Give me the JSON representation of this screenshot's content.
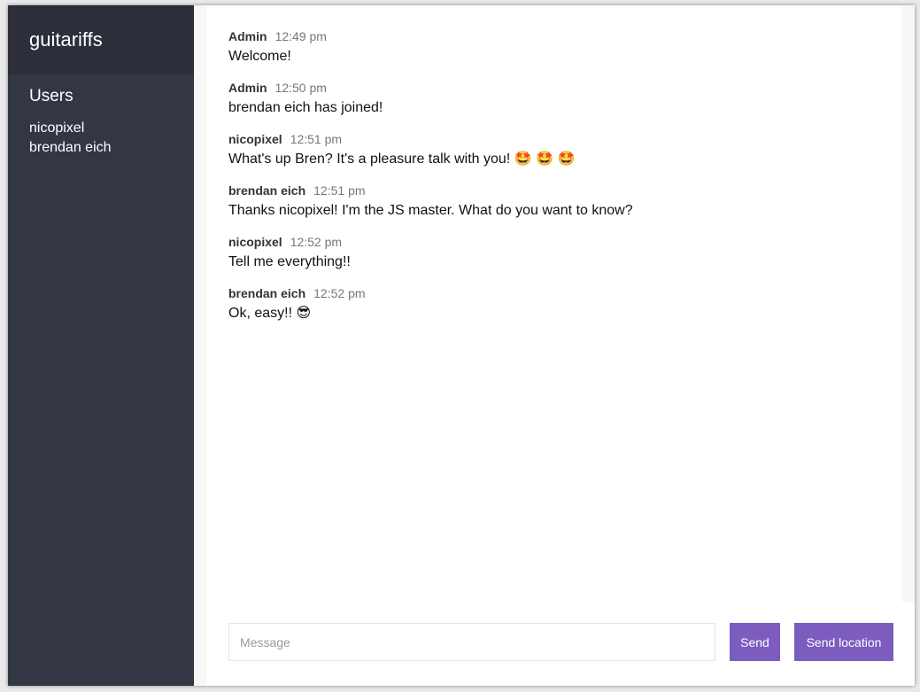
{
  "sidebar": {
    "room_name": "guitariffs",
    "users_title": "Users",
    "users": [
      "nicopixel",
      "brendan eich"
    ]
  },
  "messages": [
    {
      "username": "Admin",
      "time": "12:49 pm",
      "text": "Welcome!"
    },
    {
      "username": "Admin",
      "time": "12:50 pm",
      "text": "brendan eich has joined!"
    },
    {
      "username": "nicopixel",
      "time": "12:51 pm",
      "text": "What's up Bren? It's a pleasure talk with you! 🤩 🤩 🤩"
    },
    {
      "username": "brendan eich",
      "time": "12:51 pm",
      "text": "Thanks nicopixel! I'm the JS master. What do you want to know?"
    },
    {
      "username": "nicopixel",
      "time": "12:52 pm",
      "text": "Tell me everything!!"
    },
    {
      "username": "brendan eich",
      "time": "12:52 pm",
      "text": "Ok, easy!! 😎"
    }
  ],
  "composer": {
    "placeholder": "Message",
    "value": "",
    "send_label": "Send",
    "location_label": "Send location"
  },
  "colors": {
    "sidebar_bg": "#333744",
    "header_bg": "#2c2f3a",
    "accent": "#7c5cbf"
  }
}
